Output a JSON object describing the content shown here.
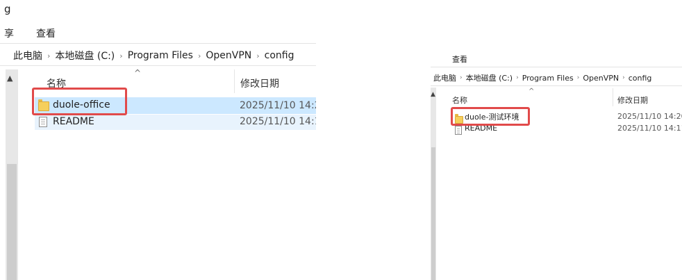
{
  "left": {
    "title_fragment": "g",
    "menu": [
      "享",
      "查看"
    ],
    "breadcrumb": [
      "此电脑",
      "本地磁盘 (C:)",
      "Program Files",
      "OpenVPN",
      "config"
    ],
    "columns": {
      "name": "名称",
      "modified": "修改日期"
    },
    "files": [
      {
        "name": "duole-office",
        "modified": "2025/11/10 14:2",
        "icon": "folder-icon",
        "selected": true
      },
      {
        "name": "README",
        "modified": "2025/11/10 14:1",
        "icon": "document-icon",
        "selected": false
      }
    ]
  },
  "right": {
    "menu": [
      "查看"
    ],
    "breadcrumb": [
      "此电脑",
      "本地磁盘 (C:)",
      "Program Files",
      "OpenVPN",
      "config"
    ],
    "columns": {
      "name": "名称",
      "modified": "修改日期"
    },
    "files": [
      {
        "name": "duole-测试环境",
        "modified": "2025/11/10 14:20",
        "icon": "folder-icon"
      },
      {
        "name": "README",
        "modified": "2025/11/10 14:11",
        "icon": "document-icon"
      }
    ]
  },
  "colors": {
    "highlight": "#cce8ff",
    "hover": "#e5f3ff",
    "annotation_red": "#e14a4a"
  }
}
